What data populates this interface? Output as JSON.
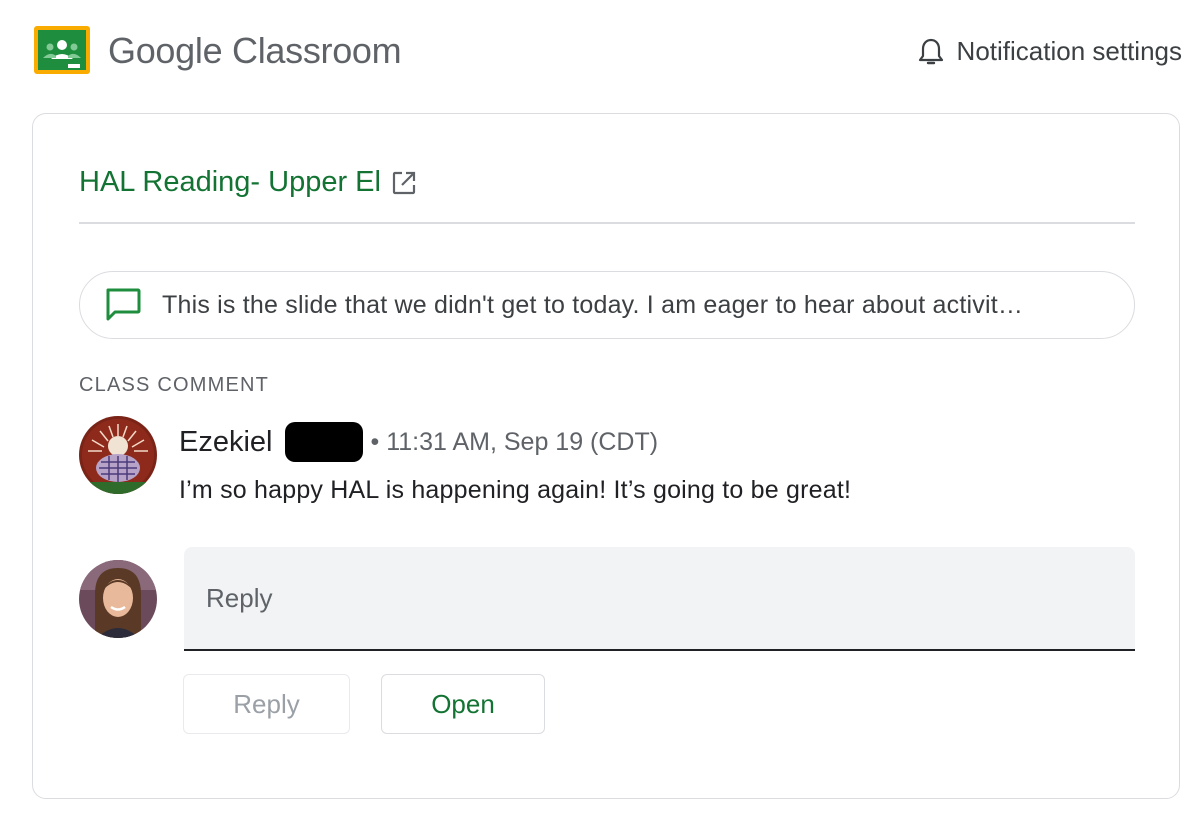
{
  "header": {
    "brand_google": "Google",
    "brand_product": "Classroom",
    "notification_settings": "Notification settings",
    "brand_color": "#1e8e3e"
  },
  "card": {
    "class_title": "HAL Reading- Upper El",
    "post_preview": "This is the slide that we didn't get to today. I am eager to hear about activit…",
    "section_label": "CLASS COMMENT",
    "comment": {
      "author": "Ezekiel",
      "author_surname_redacted": true,
      "meta": "• 11:31 AM, Sep 19 (CDT)",
      "body": "I’m so happy HAL is happening again! It’s going to be great!"
    },
    "reply": {
      "placeholder": "Reply",
      "reply_button": "Reply",
      "open_button": "Open"
    }
  },
  "colors": {
    "accent_green": "#137333",
    "border": "#dadce0",
    "input_bg": "#f1f3f4"
  },
  "icons": {
    "logo": "google-classroom-logo-icon",
    "bell": "bell-icon",
    "external": "open-in-new-icon",
    "comment": "comment-icon"
  }
}
